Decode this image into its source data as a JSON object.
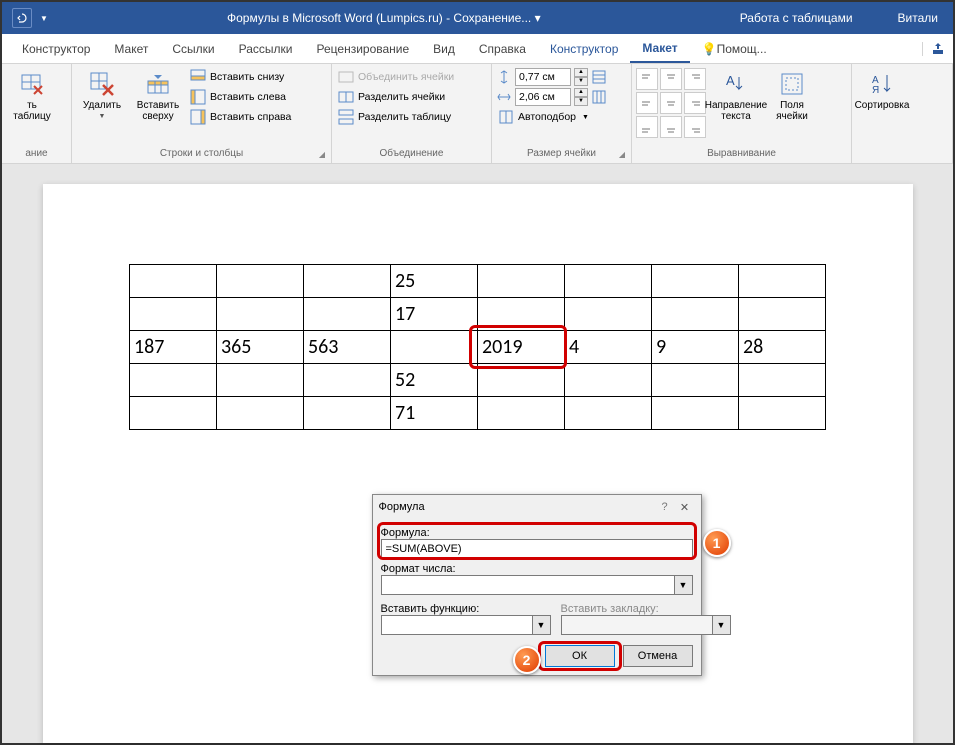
{
  "titlebar": {
    "doc_title": "Формулы в Microsoft Word (Lumpics.ru)  -  Сохранение... ▾",
    "context_tab": "Работа с таблицами",
    "user": "Витали"
  },
  "tabs": {
    "konstruktor": "Конструктор",
    "maket": "Макет",
    "ssylki": "Ссылки",
    "rassylki": "Рассылки",
    "recenz": "Рецензирование",
    "vid": "Вид",
    "spravka": "Справка",
    "konstruktor2": "Конструктор",
    "maket2": "Макет",
    "pomosh": "Помощ..."
  },
  "ribbon": {
    "draw_group": {
      "erase": "ть таблицу",
      "label": "ание"
    },
    "rowscols": {
      "delete": "Удалить",
      "insert_above": "Вставить сверху",
      "insert_below": "Вставить снизу",
      "insert_left": "Вставить слева",
      "insert_right": "Вставить справа",
      "label": "Строки и столбцы"
    },
    "merge": {
      "merge_cells": "Объединить ячейки",
      "split_cells": "Разделить ячейки",
      "split_table": "Разделить таблицу",
      "label": "Объединение"
    },
    "size": {
      "height": "0,77 см",
      "width": "2,06 см",
      "autofit": "Автоподбор",
      "label": "Размер ячейки"
    },
    "align": {
      "text_direction": "Направление текста",
      "cell_margins": "Поля ячейки",
      "label": "Выравнивание"
    },
    "data": {
      "sort": "Сортировка"
    }
  },
  "table": {
    "r1": [
      "",
      "",
      "",
      "25",
      "",
      "",
      "",
      ""
    ],
    "r2": [
      "",
      "",
      "",
      "17",
      "",
      "",
      "",
      ""
    ],
    "r3": [
      "187",
      "365",
      "563",
      "",
      "2019",
      "4",
      "9",
      "28"
    ],
    "r4": [
      "",
      "",
      "",
      "52",
      "",
      "",
      "",
      ""
    ],
    "r5": [
      "",
      "",
      "",
      "71",
      "",
      "",
      "",
      ""
    ]
  },
  "dialog": {
    "title": "Формула",
    "formula_label": "Формула:",
    "formula_value": "=SUM(ABOVE)",
    "format_label": "Формат числа:",
    "func_label": "Вставить функцию:",
    "bookmark_label": "Вставить закладку:",
    "ok": "ОК",
    "cancel": "Отмена"
  },
  "callouts": {
    "c1": "1",
    "c2": "2"
  }
}
